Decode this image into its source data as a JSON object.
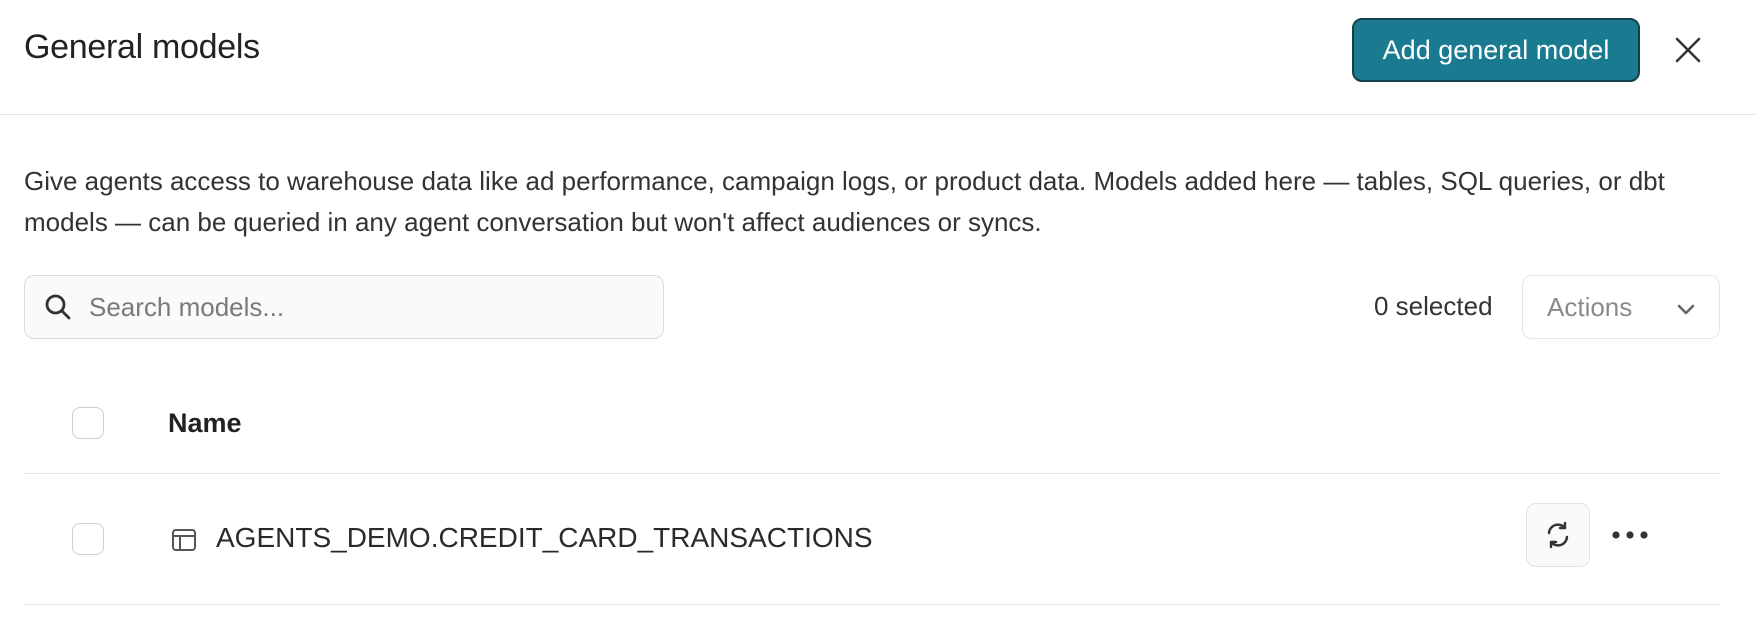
{
  "header": {
    "title": "General models",
    "add_button_label": "Add general model",
    "close_icon": "close-icon",
    "accent_color": "#1a7a8f"
  },
  "description": "Give agents access to warehouse data like ad performance, campaign logs, or product data. Models added here — tables, SQL queries, or dbt models — can be queried in any agent conversation but won't affect audiences or syncs.",
  "search": {
    "placeholder": "Search models...",
    "value": "",
    "icon": "search-icon"
  },
  "toolbar": {
    "selected_count": "0 selected",
    "actions_label": "Actions",
    "actions_icon": "chevron-down-icon"
  },
  "table": {
    "columns": [
      "Name"
    ],
    "rows": [
      {
        "name": "AGENTS_DEMO.CREDIT_CARD_TRANSACTIONS",
        "checked": false,
        "type_icon": "table-icon",
        "row_actions": [
          "refresh-icon",
          "more-horizontal-icon"
        ]
      }
    ]
  }
}
